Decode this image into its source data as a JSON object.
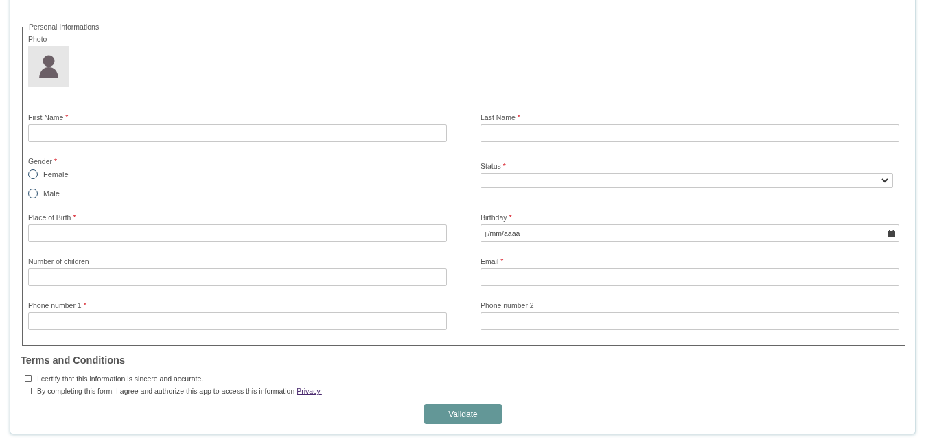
{
  "personal_informations": {
    "legend": "Personal Informations",
    "photo_label": "Photo",
    "fields": [
      {
        "kind": "text",
        "label": "First Name",
        "mark": "*"
      },
      {
        "kind": "text",
        "label": "Last Name",
        "mark": "*"
      },
      {
        "kind": "radio",
        "label": "Gender",
        "mark": "*",
        "options": [
          {
            "label": "Female",
            "selected": false
          },
          {
            "label": "Male",
            "selected": false
          }
        ]
      },
      {
        "kind": "select",
        "label": "Status",
        "mark": "*"
      },
      {
        "kind": "text",
        "label": "Place of Birth",
        "mark": "*"
      },
      {
        "kind": "date",
        "label": "Birthday",
        "mark": "*",
        "placeholder": "jj/mm/aaaa"
      },
      {
        "kind": "text",
        "label": "Number of children"
      },
      {
        "kind": "text",
        "label": "Email",
        "mark": "*"
      },
      {
        "kind": "text",
        "label": "Phone number 1",
        "mark": "*"
      },
      {
        "kind": "text",
        "label": "Phone number 2"
      }
    ]
  },
  "terms": {
    "title": "Terms and Conditions",
    "items": [
      {
        "text": "I certify that this information is sincere and accurate.",
        "checked": false
      },
      {
        "text": "By completing this form, I agree and authorize this app to access this information",
        "link": "Privacy.",
        "checked": false
      }
    ]
  },
  "validate_button": "Validate"
}
